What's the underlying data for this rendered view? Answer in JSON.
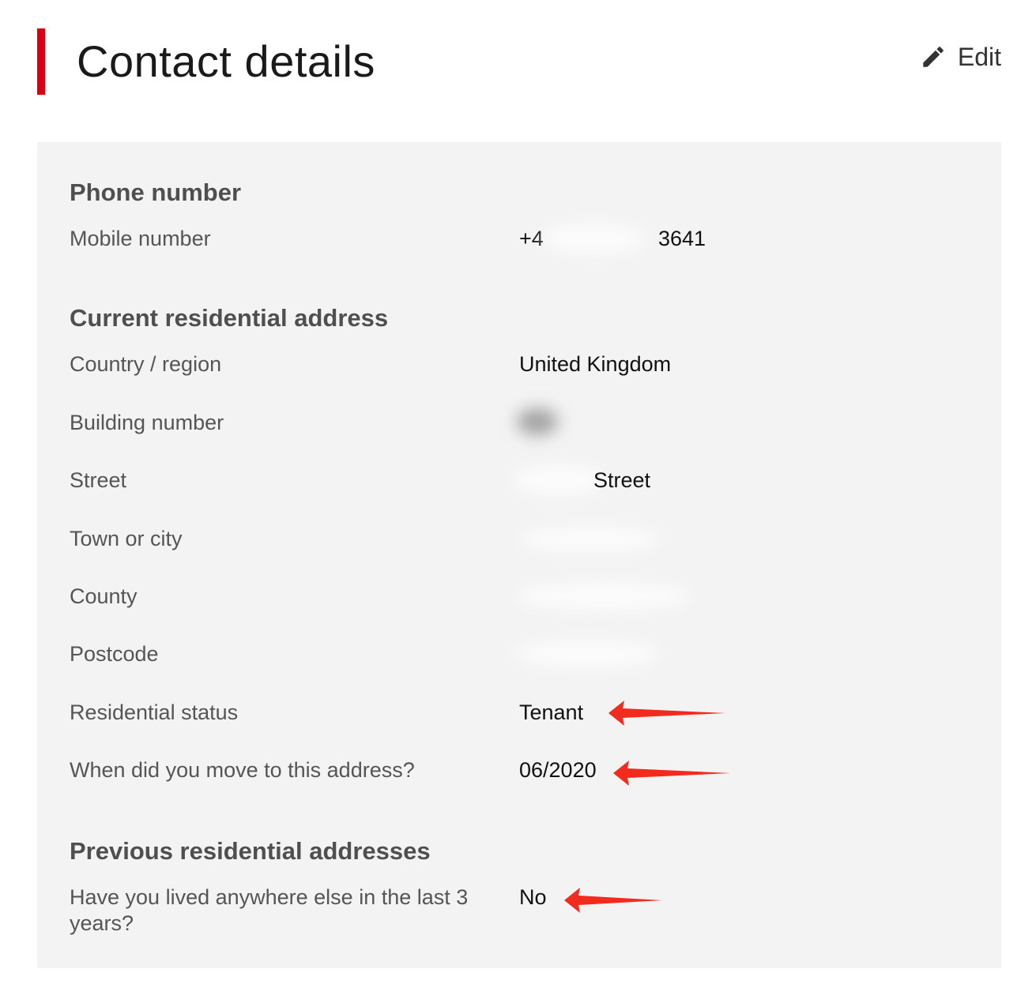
{
  "page": {
    "title": "Contact details",
    "edit_label": "Edit"
  },
  "sections": {
    "phone": {
      "title": "Phone number",
      "rows": [
        {
          "label": "Mobile number",
          "value_visible_prefix": "+4",
          "value_visible_suffix": "3641"
        }
      ]
    },
    "current_address": {
      "title": "Current residential address",
      "rows": [
        {
          "label": "Country / region",
          "value": "United Kingdom"
        },
        {
          "label": "Building number",
          "value": ""
        },
        {
          "label": "Street",
          "value": "Street"
        },
        {
          "label": "Town or city",
          "value": ""
        },
        {
          "label": "County",
          "value": ""
        },
        {
          "label": "Postcode",
          "value": ""
        },
        {
          "label": "Residential status",
          "value": "Tenant"
        },
        {
          "label": "When did you move to this address?",
          "value": "06/2020"
        }
      ]
    },
    "previous_addresses": {
      "title": "Previous residential addresses",
      "rows": [
        {
          "label": "Have you lived anywhere else in the last 3 years?",
          "value": "No"
        }
      ]
    }
  },
  "colors": {
    "accent": "#db0011",
    "panel_background": "#f3f3f3",
    "annotation_arrow": "#f22b1e"
  },
  "icons": {
    "edit": "pencil-icon",
    "annotation": "red-arrow-icon"
  }
}
